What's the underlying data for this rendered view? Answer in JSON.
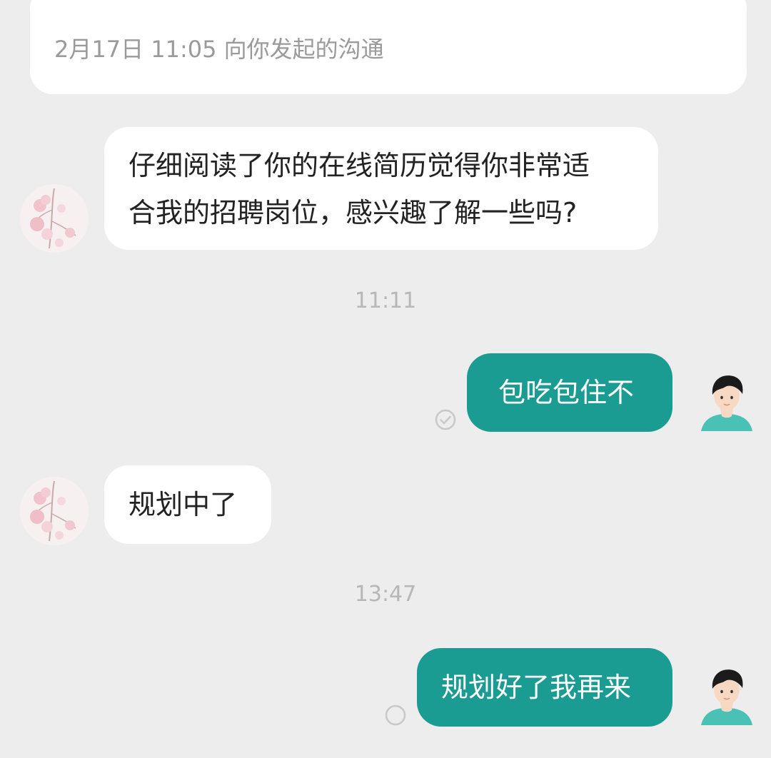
{
  "header": {
    "date": "2月17日",
    "time": "11:05",
    "note": "向你发起的沟通"
  },
  "messages": [
    {
      "side": "received",
      "lines": [
        "仔细阅读了你的在线简历觉得你非常适",
        "合我的招聘岗位，感兴趣了解一些吗?"
      ]
    },
    {
      "side": "sent",
      "time_divider": "11:11",
      "text": "包吃包住不",
      "status": "check"
    },
    {
      "side": "received",
      "text": "规划中了"
    },
    {
      "side": "sent",
      "time_divider": "13:47",
      "text": "规划好了我再来",
      "status": "circle"
    }
  ],
  "colors": {
    "background": "#ededed",
    "sent_bubble": "#1a9c93",
    "received_bubble": "#ffffff"
  },
  "icons": {
    "received_avatar": "floral-avatar-icon",
    "sent_avatar": "cartoon-boy-avatar-icon",
    "status_read": "check-circle-icon",
    "status_sent": "circle-icon"
  }
}
